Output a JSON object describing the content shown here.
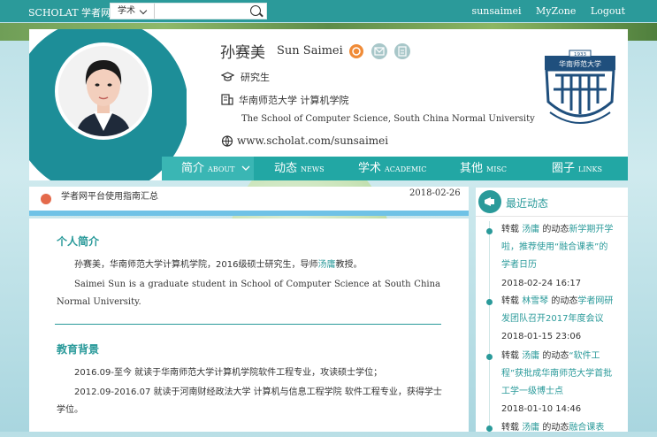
{
  "topbar": {
    "brand": "SCHOLAT 学者网",
    "search_select": "学术",
    "search_placeholder": "",
    "links": [
      "sunsaimei",
      "MyZone",
      "Logout"
    ]
  },
  "profile": {
    "name_cn": "孙赛美",
    "name_en": "Sun Saimei",
    "degree": "研究生",
    "school": "华南师范大学 计算机学院",
    "school_en": "The School of Computer Science, South China Normal University",
    "website": "www.scholat.com/sunsaimei",
    "logo_year": "1933",
    "logo_text": "华南师范大学"
  },
  "nav": [
    {
      "cn": "简介",
      "en": "ABOUT",
      "active": true
    },
    {
      "cn": "动态",
      "en": "NEWS"
    },
    {
      "cn": "学术",
      "en": "ACADEMIC"
    },
    {
      "cn": "其他",
      "en": "MISC"
    },
    {
      "cn": "圈子",
      "en": "LINKS"
    }
  ],
  "notice": {
    "text": "学者网平台使用指南汇总",
    "date": "2018-02-26"
  },
  "intro": {
    "title": "个人简介",
    "cn_prefix": "孙赛美，华南师范大学计算机学院，2016级硕士研究生，导师",
    "cn_advisor": "汤庸",
    "cn_suffix": "教授。",
    "en": "Saimei Sun is a graduate student in School of Computer Science at South China Normal University."
  },
  "education": {
    "title": "教育背景",
    "line1": "2016.09-至今 就读于华南师范大学计算机学院软件工程专业，攻读硕士学位；",
    "line2": "2012.09-2016.07 就读于河南财经政法大学 计算机与信息工程学院 软件工程专业，获得学士学位。"
  },
  "sidebar": {
    "title": "最近动态",
    "items": [
      {
        "pre": "转载 ",
        "user": "汤庸",
        "mid": " 的动态",
        "link": "新学期开学啦，推荐使用“融合课表”的学者日历",
        "date": "2018-02-24 16:17"
      },
      {
        "pre": "转载 ",
        "user": "林雪琴",
        "mid": " 的动态",
        "link": "学者网研发团队召开2017年度会议",
        "date": "2018-01-15 23:06"
      },
      {
        "pre": "转载 ",
        "user": "汤庸",
        "mid": " 的动态",
        "link": "“软件工程”获批成华南师范大学首批工学一级博士点",
        "date": "2018-01-10 14:46"
      },
      {
        "pre": "转载 ",
        "user": "汤庸",
        "mid": " 的动态",
        "link": "融合课表",
        "date": ""
      }
    ]
  },
  "colors": {
    "teal": "#2a9a9a",
    "nav": "#22a7a4",
    "topbar": "#2b9a9a"
  }
}
